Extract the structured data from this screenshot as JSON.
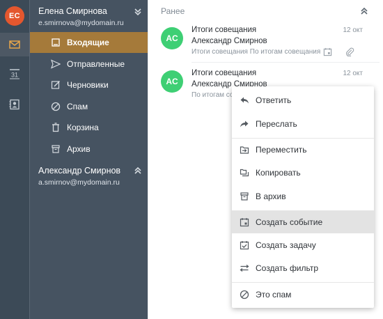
{
  "rail": {
    "avatar_initials": "EC",
    "items": [
      {
        "icon": "mail-icon",
        "active": true
      },
      {
        "icon": "calendar-icon",
        "calendar_day": "31"
      },
      {
        "icon": "contacts-icon"
      }
    ]
  },
  "accounts": [
    {
      "name": "Елена Смирнова",
      "email": "e.smirnova@mydomain.ru",
      "folders": [
        {
          "label": "Входящие",
          "icon": "inbox-icon",
          "active": true
        },
        {
          "label": "Отправленные",
          "icon": "sent-icon"
        },
        {
          "label": "Черновики",
          "icon": "drafts-icon"
        },
        {
          "label": "Спам",
          "icon": "spam-icon"
        },
        {
          "label": "Корзина",
          "icon": "trash-icon"
        },
        {
          "label": "Архив",
          "icon": "archive-icon"
        }
      ]
    },
    {
      "name": "Александр Смирнов",
      "email": "a.smirnov@mydomain.ru"
    }
  ],
  "list": {
    "section_title": "Ранее",
    "messages": [
      {
        "initials": "AC",
        "subject": "Итоги совещания",
        "date": "12 окт",
        "from": "Александр Смирнов",
        "preview": "Итоги совещания По итогам совещания"
      },
      {
        "initials": "AC",
        "subject": "Итоги совещания",
        "date": "12 окт",
        "from": "Александр Смирнов",
        "preview": "По итогам совещания"
      }
    ]
  },
  "context_menu": {
    "items": [
      {
        "label": "Ответить",
        "icon": "reply-icon"
      },
      {
        "label": "Переслать",
        "icon": "forward-icon"
      },
      {
        "label": "Переместить",
        "icon": "move-icon"
      },
      {
        "label": "Копировать",
        "icon": "copy-icon"
      },
      {
        "label": "В архив",
        "icon": "archive-icon"
      },
      {
        "label": "Создать событие",
        "icon": "create-event-icon",
        "highlighted": true
      },
      {
        "label": "Создать задачу",
        "icon": "create-task-icon"
      },
      {
        "label": "Создать фильтр",
        "icon": "create-filter-icon"
      },
      {
        "label": "Это спам",
        "icon": "spam-icon"
      }
    ]
  },
  "colors": {
    "rail_bg": "#3c4a57",
    "folders_bg": "#465361",
    "active_folder": "#a57a3a",
    "account_avatar": "#e4572e",
    "message_avatar": "#3ecf74"
  }
}
